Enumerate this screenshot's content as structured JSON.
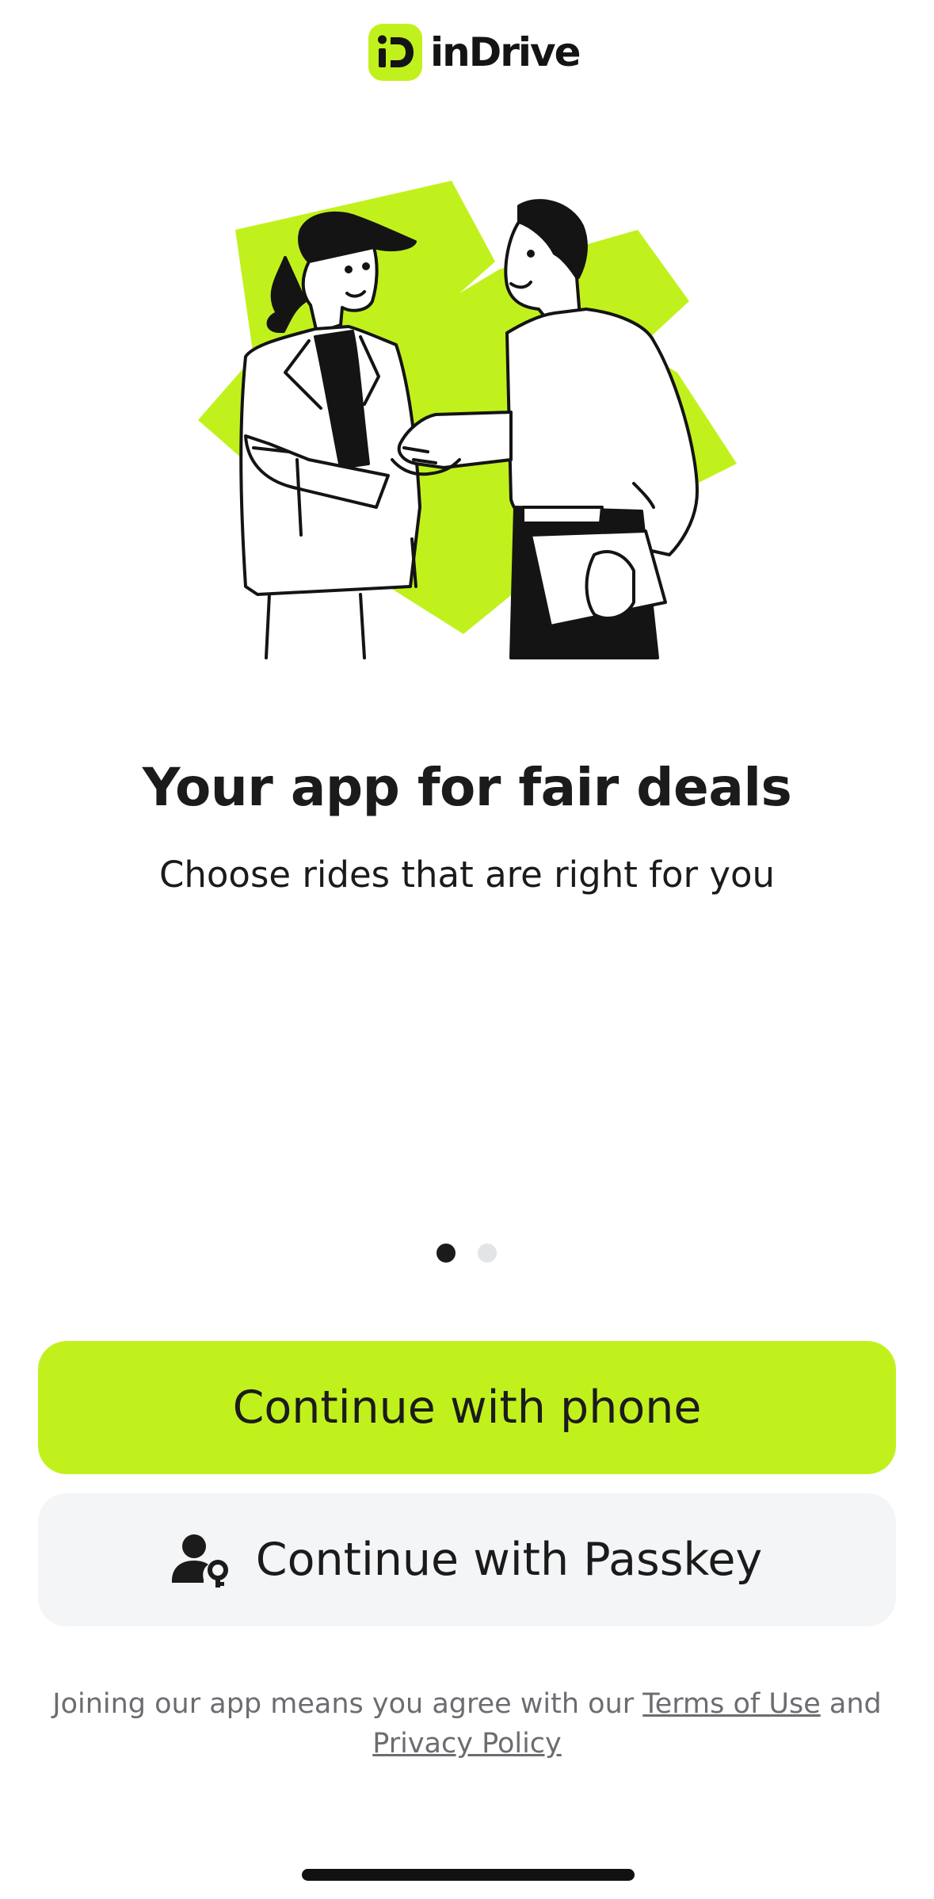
{
  "brand": {
    "name": "inDrive",
    "accent_color": "#c1f11d",
    "logo_icon": "indrive-logo-icon"
  },
  "hero": {
    "illustration": "handshake-illustration"
  },
  "onboarding": {
    "title": "Your app for fair deals",
    "subtitle": "Choose rides that are right for you",
    "page_count": 2,
    "active_page": 1
  },
  "actions": {
    "phone_label": "Continue with phone",
    "passkey_label": "Continue with Passkey",
    "passkey_icon": "user-key-icon"
  },
  "legal": {
    "prefix": "Joining our app means you agree with our",
    "terms_label": "Terms of Use",
    "conjunction": "and",
    "privacy_label": "Privacy Policy"
  }
}
